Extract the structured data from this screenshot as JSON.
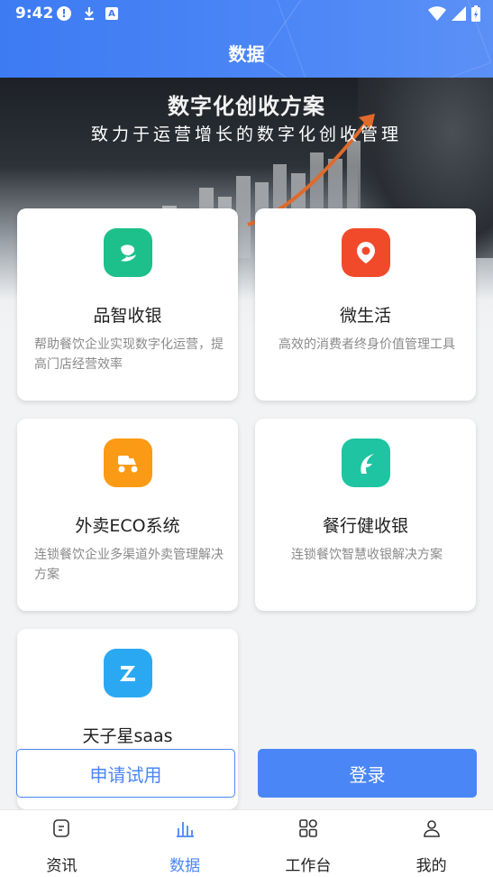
{
  "status_bar": {
    "time": "9:42"
  },
  "header": {
    "title": "数据"
  },
  "banner": {
    "headline": "数字化创收方案",
    "subline": "致力于运营增长的数字化创收管理"
  },
  "products": [
    {
      "name": "品智收银",
      "desc": "帮助餐饮企业实现数字化运营，提高门店经营效率",
      "color": "#1dc08a",
      "icon": "pinzhi-logo-icon"
    },
    {
      "name": "微生活",
      "desc": "高效的消费者终身价值管理工具",
      "color": "#f14a2a",
      "icon": "weishenghuo-logo-icon"
    },
    {
      "name": "外卖ECO系统",
      "desc": "连锁餐饮企业多渠道外卖管理解决方案",
      "color": "#fb9a14",
      "icon": "waimai-logo-icon"
    },
    {
      "name": "餐行健收银",
      "desc": "连锁餐饮智慧收银解决方案",
      "color": "#1fc4a2",
      "icon": "canxingjian-logo-icon"
    },
    {
      "name": "天子星saas",
      "desc": "",
      "color": "#2aa9f2",
      "icon": "tianzixing-logo-icon"
    }
  ],
  "actions": {
    "trial": "申请试用",
    "login": "登录"
  },
  "nav": [
    {
      "label": "资讯",
      "icon": "news-icon",
      "active": false
    },
    {
      "label": "数据",
      "icon": "data-chart-icon",
      "active": true
    },
    {
      "label": "工作台",
      "icon": "workbench-grid-icon",
      "active": false
    },
    {
      "label": "我的",
      "icon": "profile-icon",
      "active": false
    }
  ],
  "colors": {
    "primary": "#4a86f5",
    "header": "#3d7bf3"
  }
}
